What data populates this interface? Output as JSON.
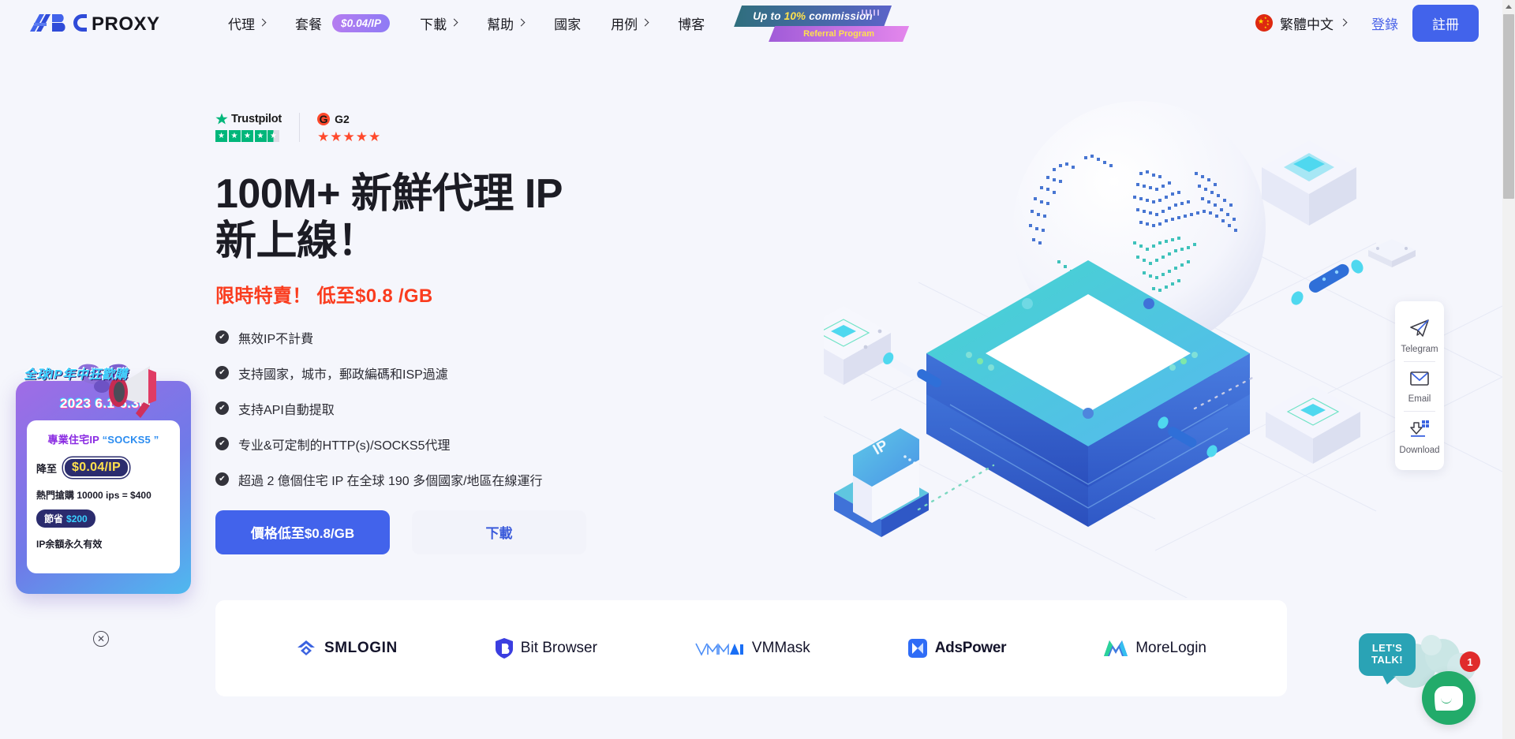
{
  "brand": {
    "name": "ABCPROXY",
    "accent": "#4263eb"
  },
  "header": {
    "nav": [
      {
        "label": "代理",
        "has_chevron": true
      },
      {
        "label": "套餐",
        "has_chevron": false,
        "pill": "$0.04/IP"
      },
      {
        "label": "下載",
        "has_chevron": true
      },
      {
        "label": "幫助",
        "has_chevron": true
      },
      {
        "label": "國家",
        "has_chevron": false
      },
      {
        "label": "用例",
        "has_chevron": true
      },
      {
        "label": "博客",
        "has_chevron": false
      }
    ],
    "ribbon": {
      "line1_pre": "Up to ",
      "line1_highlight": "10%",
      "line1_post": " commission",
      "line2": "Referral Program"
    },
    "language": "繁體中文",
    "login": "登錄",
    "signup": "註冊"
  },
  "hero": {
    "badges": {
      "trustpilot_label": "Trustpilot",
      "trustpilot_rating": 4.5,
      "g2_label": "G2",
      "g2_rating": 4.5
    },
    "title_line1": "100M+ 新鮮代理 IP",
    "title_line2": "新上線！",
    "subtitle": "限時特賣！ 低至$0.8 /GB",
    "features": [
      "無效IP不計費",
      "支持國家，城市，郵政編碼和ISP過濾",
      "支持API自動提取",
      "专业&可定制的HTTP(s)/SOCKS5代理",
      "超過 2 億個住宅 IP 在全球 190 多個國家/地區在線運行"
    ],
    "cta_primary": "價格低至$0.8/GB",
    "cta_secondary": "下載",
    "art_label": "IP"
  },
  "partners": [
    {
      "name": "SMLOGIN",
      "icon": "smlogin-logo-icon"
    },
    {
      "name": "Bit Browser",
      "icon": "bitbrowser-logo-icon"
    },
    {
      "name": "VMMask",
      "icon": "vmmask-logo-icon"
    },
    {
      "name": "AdsPower",
      "icon": "adspower-logo-icon"
    },
    {
      "name": "MoreLogin",
      "icon": "morelogin-logo-icon"
    }
  ],
  "promo": {
    "banner": "全球IP年中狂歡購",
    "date": "2023 6.1-6.30",
    "line1_a": "專業住宅IP",
    "line1_b": "“SOCKS5 ”",
    "price_label": "降至",
    "price_value": "$0.04/IP",
    "hot": "熱門搶購 10000 ips = $400",
    "save_label": "節省",
    "save_value": "$200",
    "note": "IP余額永久有效",
    "close": "✕"
  },
  "rail": [
    {
      "label": "Telegram",
      "icon": "telegram-icon"
    },
    {
      "label": "Email",
      "icon": "email-icon"
    },
    {
      "label": "Download",
      "icon": "download-icon"
    }
  ],
  "chat": {
    "bubble": "LET'S\nTALK!",
    "badge": "1"
  },
  "scrollbar": {
    "position": "top"
  }
}
